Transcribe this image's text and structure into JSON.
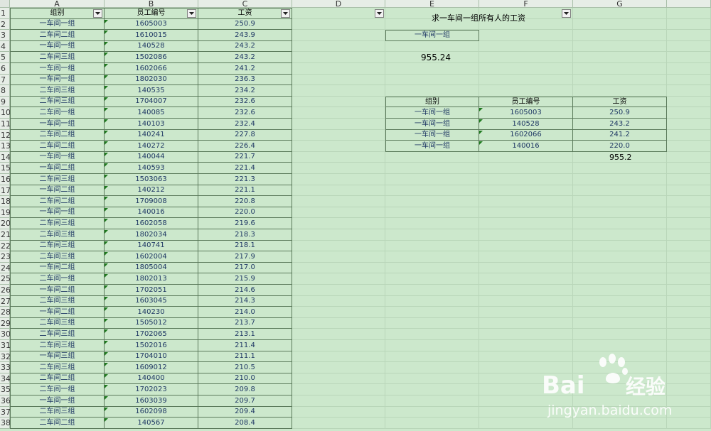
{
  "columns": [
    "A",
    "B",
    "C",
    "D",
    "E",
    "F",
    "G"
  ],
  "row_numbers": [
    "1",
    "2",
    "3",
    "4",
    "5",
    "6",
    "7",
    "8",
    "9",
    "10",
    "11",
    "12",
    "13",
    "14",
    "15",
    "16",
    "17",
    "18",
    "19",
    "20",
    "21",
    "22",
    "23",
    "24",
    "25",
    "26",
    "27",
    "28",
    "29",
    "30",
    "31",
    "32",
    "33",
    "34",
    "35",
    "36",
    "37",
    "38"
  ],
  "source_table": {
    "headers": [
      "组别",
      "员工编号",
      "工资"
    ],
    "rows": [
      [
        "一车间一组",
        "1605003",
        "250.9"
      ],
      [
        "二车间二组",
        "1610015",
        "243.9"
      ],
      [
        "一车间一组",
        "140528",
        "243.2"
      ],
      [
        "二车间三组",
        "1502086",
        "243.2"
      ],
      [
        "一车间一组",
        "1602066",
        "241.2"
      ],
      [
        "一车间一组",
        "1802030",
        "236.3"
      ],
      [
        "二车间三组",
        "140535",
        "234.2"
      ],
      [
        "二车间三组",
        "1704007",
        "232.6"
      ],
      [
        "二车间一组",
        "140085",
        "232.6"
      ],
      [
        "一车间一组",
        "140103",
        "232.4"
      ],
      [
        "二车间二组",
        "140241",
        "227.8"
      ],
      [
        "二车间二组",
        "140272",
        "226.4"
      ],
      [
        "一车间一组",
        "140044",
        "221.7"
      ],
      [
        "一车间二组",
        "140593",
        "221.4"
      ],
      [
        "二车间三组",
        "1503063",
        "221.3"
      ],
      [
        "一车间二组",
        "140212",
        "221.1"
      ],
      [
        "二车间二组",
        "1709008",
        "220.8"
      ],
      [
        "一车间一组",
        "140016",
        "220.0"
      ],
      [
        "二车间三组",
        "1602058",
        "219.6"
      ],
      [
        "二车间三组",
        "1802034",
        "218.3"
      ],
      [
        "二车间三组",
        "140741",
        "218.1"
      ],
      [
        "二车间三组",
        "1602004",
        "217.9"
      ],
      [
        "一车间二组",
        "1805004",
        "217.0"
      ],
      [
        "二车间一组",
        "1802013",
        "215.9"
      ],
      [
        "一车间二组",
        "1702051",
        "214.6"
      ],
      [
        "二车间三组",
        "1603045",
        "214.3"
      ],
      [
        "一车间二组",
        "140230",
        "214.0"
      ],
      [
        "二车间三组",
        "1505012",
        "213.7"
      ],
      [
        "二车间三组",
        "1702065",
        "213.1"
      ],
      [
        "二车间三组",
        "1502016",
        "211.4"
      ],
      [
        "一车间三组",
        "1704010",
        "211.1"
      ],
      [
        "二车间三组",
        "1609012",
        "210.5"
      ],
      [
        "二车间二组",
        "140400",
        "210.0"
      ],
      [
        "二车间一组",
        "1702023",
        "209.8"
      ],
      [
        "一车间一组",
        "1603039",
        "209.7"
      ],
      [
        "二车间三组",
        "1602098",
        "209.4"
      ],
      [
        "二车间二组",
        "140567",
        "208.4"
      ]
    ]
  },
  "right_panel": {
    "title": "求一车间一组所有人的工资",
    "criteria_value": "一车间一组",
    "formula_result": "955.24",
    "result_table": {
      "headers": [
        "组别",
        "员工编号",
        "工资"
      ],
      "rows": [
        [
          "一车间一组",
          "1605003",
          "250.9"
        ],
        [
          "一车间一组",
          "140528",
          "243.2"
        ],
        [
          "一车间一组",
          "1602066",
          "241.2"
        ],
        [
          "一车间一组",
          "140016",
          "220.0"
        ]
      ]
    },
    "result_total": "955.2"
  },
  "watermark": {
    "brand": "Bai",
    "brand_tail": "经验",
    "url": "jingyan.baidu.com"
  },
  "colors": {
    "cell_bg": "#cce8cc",
    "header_bg": "#e6ede6",
    "text": "#1f3864",
    "comment_marker": "#1e7a1e"
  }
}
